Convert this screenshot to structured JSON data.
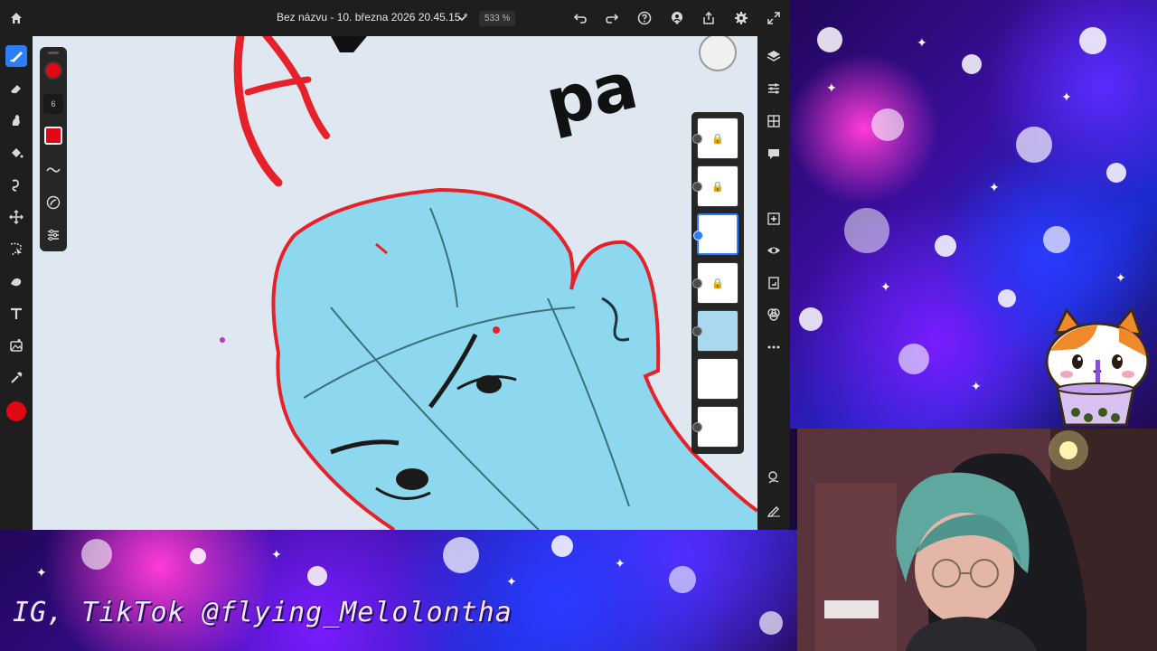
{
  "app": {
    "doc_title": "Bez názvu - 10. března 2026 20.45.15 *",
    "zoom": "533 %",
    "brush_size": "6",
    "brush_color": "#e30613",
    "accent_color": "#2d7ff9",
    "layers": [
      {
        "locked": true,
        "lock_glyph": "🔒",
        "selected": false
      },
      {
        "locked": true,
        "lock_glyph": "🔒",
        "selected": false
      },
      {
        "locked": false,
        "lock_glyph": "",
        "selected": true
      },
      {
        "locked": true,
        "lock_glyph": "🔒",
        "selected": false
      },
      {
        "locked": false,
        "lock_glyph": "",
        "selected": false
      },
      {
        "locked": false,
        "lock_glyph": "",
        "selected": false
      },
      {
        "locked": false,
        "lock_glyph": "",
        "selected": false
      }
    ],
    "top_icons": [
      "home-icon",
      "undo-icon",
      "redo-icon",
      "help-icon",
      "share-live-icon",
      "export-icon",
      "settings-icon",
      "fullscreen-icon"
    ],
    "left_tools": [
      "paint-brush-icon",
      "eraser-icon",
      "smudge-icon",
      "fill-icon",
      "liquify-icon",
      "move-icon",
      "select-icon",
      "shape-icon",
      "text-icon",
      "place-image-icon",
      "eyedropper-icon"
    ],
    "right_tools": [
      "layers-icon",
      "adjustments-icon",
      "grid-icon",
      "comments-icon",
      "add-layer-icon",
      "visibility-icon",
      "layer-actions-icon",
      "blend-icon",
      "more-icon",
      "motion-icon",
      "pen-icon"
    ]
  },
  "overlay": {
    "social_handle": "IG, TikTok @flying_Melolontha"
  }
}
